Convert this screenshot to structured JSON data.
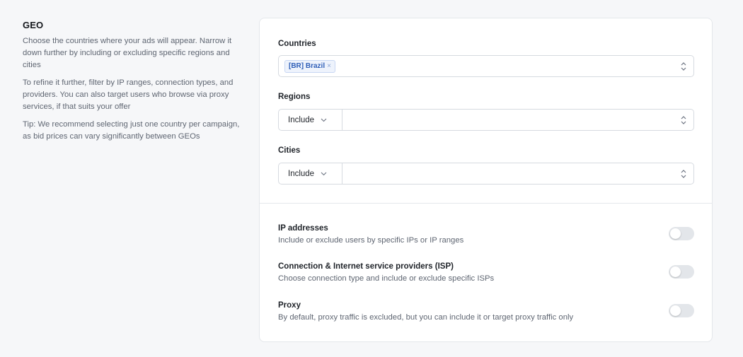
{
  "geo": {
    "title": "GEO",
    "paragraphs": [
      "Choose the countries where your ads will appear. Narrow it down further by including or excluding specific regions and cities",
      "To refine it further, filter by IP ranges, connection types, and providers. You can also target users who browse via proxy services, if that suits your offer",
      "Tip: We recommend selecting just one country per campaign, as bid prices can vary significantly between GEOs"
    ]
  },
  "countries": {
    "label": "Countries",
    "selected_tag": "[BR] Brazil",
    "remove_icon": "×"
  },
  "regions": {
    "label": "Regions",
    "mode": "Include"
  },
  "cities": {
    "label": "Cities",
    "mode": "Include"
  },
  "toggles": [
    {
      "title": "IP addresses",
      "description": "Include or exclude users by specific IPs or IP ranges",
      "enabled": false
    },
    {
      "title": "Connection & Internet service providers (ISP)",
      "description": "Choose connection type and include or exclude specific ISPs",
      "enabled": false
    },
    {
      "title": "Proxy",
      "description": "By default, proxy traffic is excluded, but you can include it or target proxy traffic only",
      "enabled": false
    }
  ],
  "colors": {
    "page_bg": "#f6f7f9",
    "card_bg": "#ffffff",
    "tag_bg": "#eef3fc",
    "tag_text": "#2f5fb8",
    "toggle_off": "#e3e6ea"
  },
  "icons": {
    "select_arrows": "updown-chevron-icon",
    "mode_dropdown": "chevron-down-icon",
    "tag_remove": "close-icon"
  }
}
